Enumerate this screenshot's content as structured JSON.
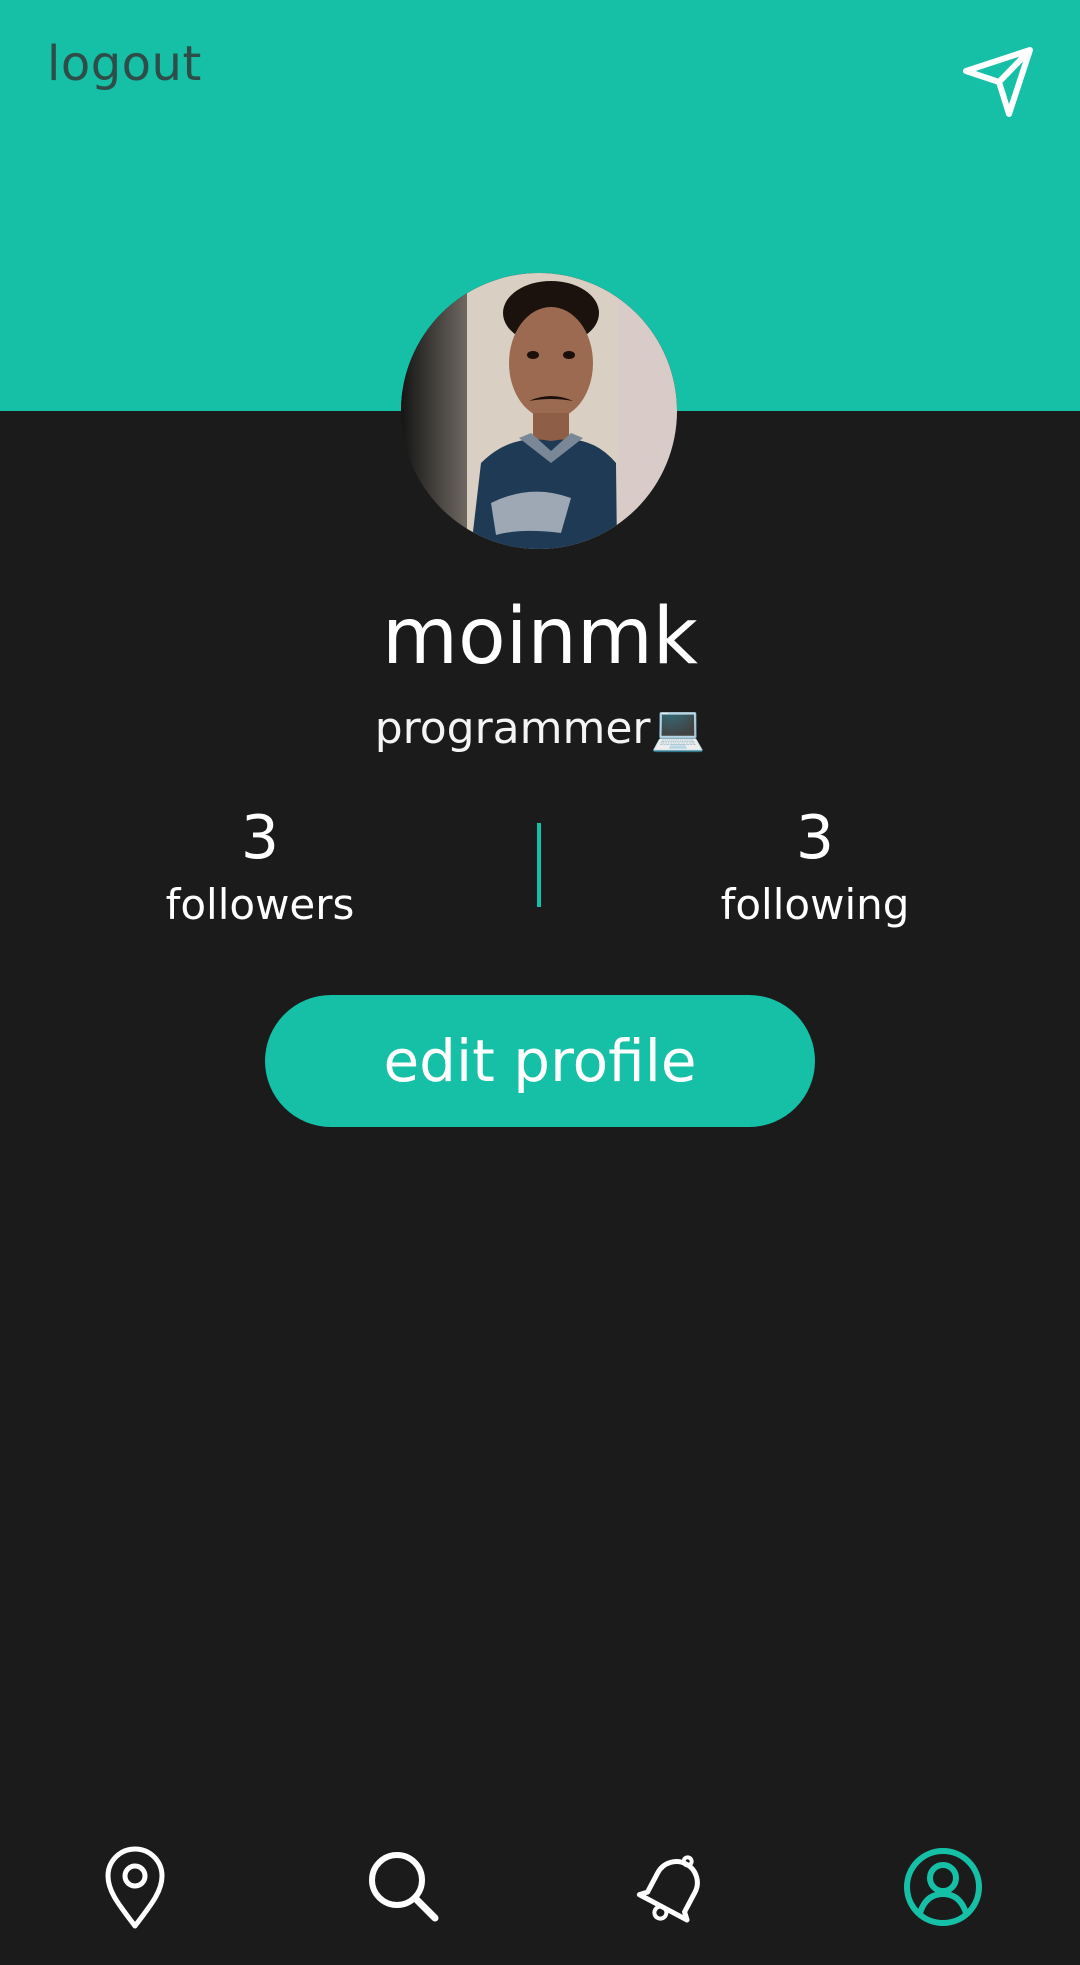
{
  "header": {
    "logout_label": "logout",
    "send_icon": "send-icon",
    "color": "#15c0a7"
  },
  "profile": {
    "username": "moinmk",
    "bio": "programmer💻",
    "followers": {
      "count": "3",
      "label": "followers"
    },
    "following": {
      "count": "3",
      "label": "following"
    },
    "edit_label": "edit profile"
  },
  "nav": {
    "items": [
      {
        "icon": "map-pin-icon",
        "active": false
      },
      {
        "icon": "search-icon",
        "active": false
      },
      {
        "icon": "bell-icon",
        "active": false
      },
      {
        "icon": "profile-icon",
        "active": true
      }
    ],
    "active_color": "#15c0a7",
    "inactive_color": "#ffffff"
  },
  "colors": {
    "accent": "#15c0a7",
    "background": "#1c1b1c"
  }
}
